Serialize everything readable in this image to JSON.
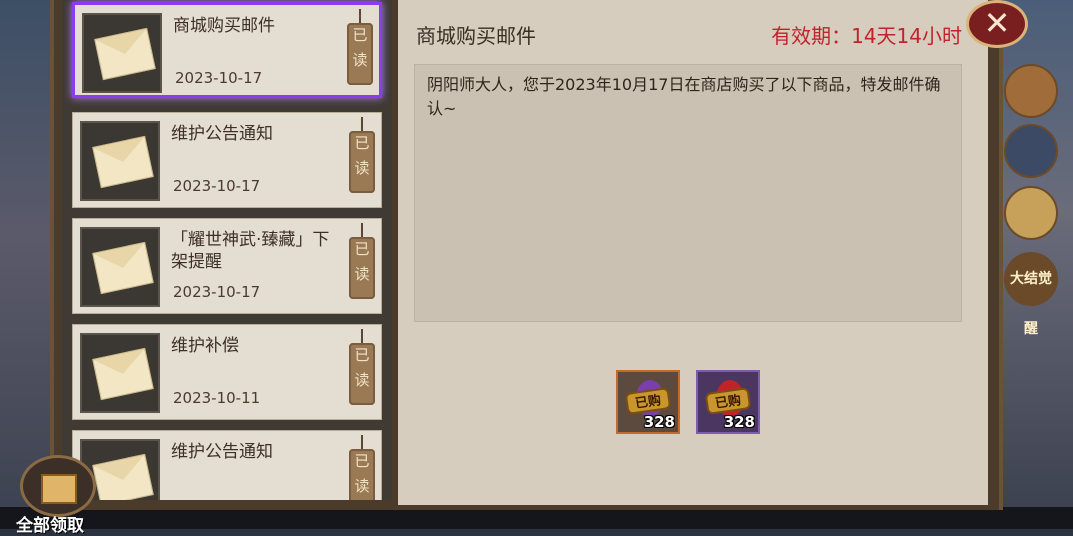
{
  "mail_list": [
    {
      "title": "商城购买邮件",
      "date": "2023-10-17",
      "status": [
        "已",
        "读"
      ],
      "selected": true
    },
    {
      "title": "维护公告通知",
      "date": "2023-10-17",
      "status": [
        "已",
        "读"
      ],
      "selected": false
    },
    {
      "title": "「耀世神武·臻藏」下架提醒",
      "date": "2023-10-17",
      "status": [
        "已",
        "读"
      ],
      "selected": false
    },
    {
      "title": "维护补偿",
      "date": "2023-10-11",
      "status": [
        "已",
        "读"
      ],
      "selected": false
    },
    {
      "title": "维护公告通知",
      "date": "",
      "status": [
        "已",
        "读"
      ],
      "selected": false
    }
  ],
  "detail": {
    "title": "商城购买邮件",
    "validity": "有效期：14天14小时",
    "body": "阴阳师大人，您于2023年10月17日在商店购买了以下商品，特发邮件确认~",
    "attachments": [
      {
        "stamp": "已购",
        "quantity": "328",
        "color": "#7a3fa8"
      },
      {
        "stamp": "已购",
        "quantity": "328",
        "color": "#c0242a"
      }
    ]
  },
  "claim_all_label": "全部领取",
  "close_icon": "close-icon",
  "side_banner_text": "大结觉醒"
}
